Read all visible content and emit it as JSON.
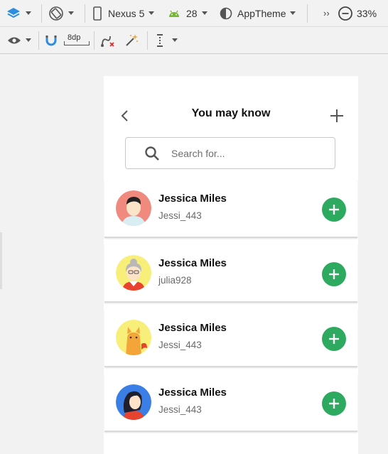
{
  "toolbar": {
    "device": "Nexus 5",
    "api_level": "28",
    "theme": "AppTheme",
    "overflow": "››",
    "zoom": "33%",
    "margin": "8dp"
  },
  "screen": {
    "title": "You may know",
    "search_placeholder": "Search for..."
  },
  "people": [
    {
      "name": "Jessica Miles",
      "username": "Jessi_443",
      "avatar": "man-avatar-icon",
      "bg": "#f08a7e"
    },
    {
      "name": "Jessica Miles",
      "username": "julia928",
      "avatar": "grandma-avatar-icon",
      "bg": "#f8ef7a"
    },
    {
      "name": "Jessica Miles",
      "username": "Jessi_443",
      "avatar": "cat-avatar-icon",
      "bg": "#f8ef7a"
    },
    {
      "name": "Jessica Miles",
      "username": "Jessi_443",
      "avatar": "woman-avatar-icon",
      "bg": "#3b7fe6"
    }
  ],
  "colors": {
    "accent_green": "#2daa5f",
    "layers_blue": "#2d8ee0",
    "android_green": "#78b830"
  }
}
